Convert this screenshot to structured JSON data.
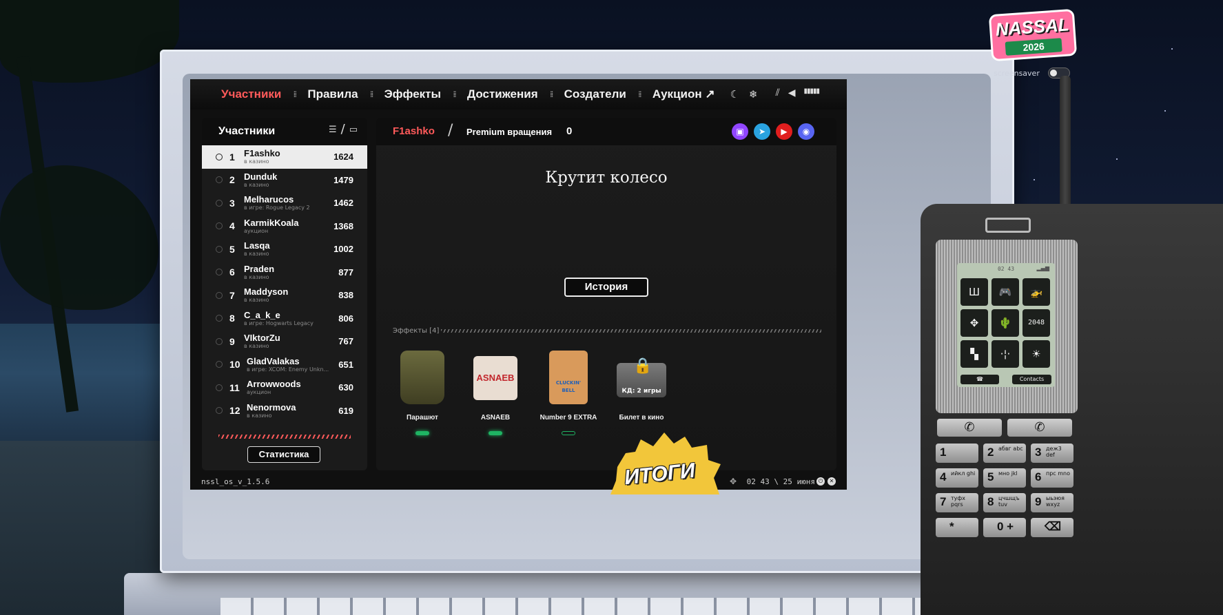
{
  "nav": {
    "items": [
      "Участники",
      "Правила",
      "Эффекты",
      "Достижения",
      "Создатели",
      "Аукцион ↗"
    ],
    "active_index": 0
  },
  "participants": {
    "title": "Участники",
    "rows": [
      {
        "rank": "1",
        "name": "F1ashko",
        "status": "в казино",
        "score": "1624"
      },
      {
        "rank": "2",
        "name": "Dunduk",
        "status": "в казино",
        "score": "1479"
      },
      {
        "rank": "3",
        "name": "Melharucos",
        "status": "в игре: Rogue Legacy 2",
        "score": "1462"
      },
      {
        "rank": "4",
        "name": "KarmikKoala",
        "status": "аукцион",
        "score": "1368"
      },
      {
        "rank": "5",
        "name": "Lasqa",
        "status": "в казино",
        "score": "1002"
      },
      {
        "rank": "6",
        "name": "Praden",
        "status": "в казино",
        "score": "877"
      },
      {
        "rank": "7",
        "name": "Maddyson",
        "status": "в казино",
        "score": "838"
      },
      {
        "rank": "8",
        "name": "C_a_k_e",
        "status": "в игре: Hogwarts Legacy",
        "score": "806"
      },
      {
        "rank": "9",
        "name": "VIktorZu",
        "status": "в казино",
        "score": "767"
      },
      {
        "rank": "10",
        "name": "GladValakas",
        "status": "в игре: XCOM: Enemy Unkn...",
        "score": "651"
      },
      {
        "rank": "11",
        "name": "Arrowwoods",
        "status": "аукцион",
        "score": "630"
      },
      {
        "rank": "12",
        "name": "Nenormova",
        "status": "в казино",
        "score": "619"
      }
    ],
    "stats_button": "Статистика"
  },
  "main": {
    "username": "F1ashko",
    "premium_label": "Premium вращения",
    "premium_count": "0",
    "spin_title": "Крутит колесо",
    "history_button": "История",
    "effects_label": "Эффекты [4]",
    "effects": [
      {
        "name": "Парашют",
        "active": true,
        "overlay": ""
      },
      {
        "name": "ASNAEB",
        "active": true,
        "overlay": ""
      },
      {
        "name": "Number 9 EXTRA",
        "active": false,
        "overlay": ""
      },
      {
        "name": "Билет в кино",
        "active": false,
        "overlay": "КД: 2 игры"
      }
    ],
    "effect_image_texts": [
      "ASNAEB",
      "CLUCKIN' BELL"
    ],
    "socials": [
      "twitch-icon",
      "telegram-icon",
      "youtube-icon",
      "discord-icon"
    ]
  },
  "footer": {
    "version": "nssl_os_v_1.5.6",
    "clock": "02 43 \\ 25 июня"
  },
  "badge": {
    "label": "ИТОГИ"
  },
  "logo": {
    "name": "NASSAL",
    "year": "2026"
  },
  "screensaver": {
    "label": "screensaver",
    "enabled": false
  },
  "phone": {
    "clock": "02 43",
    "apps": [
      "Ш",
      "🎮",
      "🚁",
      "✥",
      "🌵",
      "2048",
      "▚",
      "·¦·",
      "☀"
    ],
    "contacts": "Contacts",
    "keys": [
      {
        "digit": "1",
        "letters": ""
      },
      {
        "digit": "2",
        "letters": "абвг abc"
      },
      {
        "digit": "3",
        "letters": "деж3 def"
      },
      {
        "digit": "4",
        "letters": "ийкл ghi"
      },
      {
        "digit": "5",
        "letters": "мно jkl"
      },
      {
        "digit": "6",
        "letters": "прс mno"
      },
      {
        "digit": "7",
        "letters": "туфх pqrs"
      },
      {
        "digit": "8",
        "letters": "цчшщъ tuv"
      },
      {
        "digit": "9",
        "letters": "ыьэюя wxyz"
      },
      {
        "digit": "*",
        "letters": ""
      },
      {
        "digit": "0 +",
        "letters": ""
      },
      {
        "digit": "⌫",
        "letters": ""
      }
    ]
  },
  "colors": {
    "accent": "#ff5a5a",
    "active_pill": "#1fb463"
  }
}
